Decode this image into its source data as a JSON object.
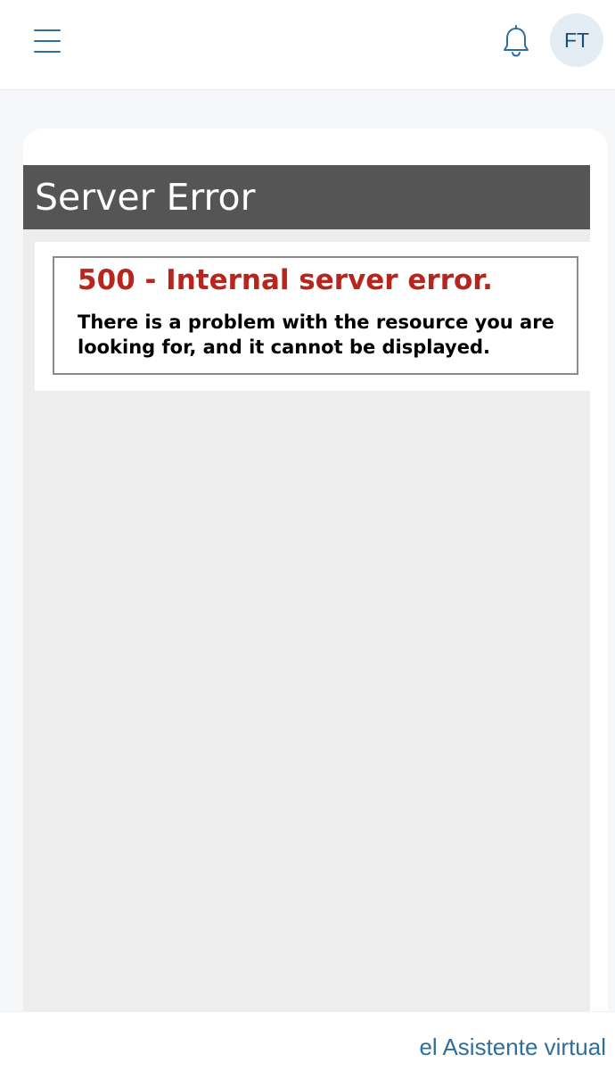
{
  "header": {
    "menu_icon": "hamburger-menu-icon",
    "notifications_icon": "bell-icon",
    "avatar_initials": "FT"
  },
  "error_page": {
    "title": "Server Error",
    "code_message": "500 - Internal server error.",
    "description": "There is a problem with the resource you are looking for, and it cannot be displayed."
  },
  "footer": {
    "assistant_label": "el Asistente virtual"
  },
  "colors": {
    "brand_blue": "#2f6f9f",
    "avatar_bg": "#e4edf4",
    "error_header_bg": "#555555",
    "error_red": "#b7251d",
    "iframe_bg": "#ededed",
    "page_bg": "#f6f7f9"
  }
}
